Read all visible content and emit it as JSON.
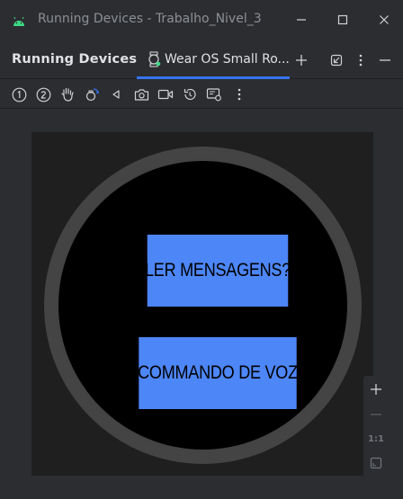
{
  "window": {
    "title": "Running Devices - Trabalho_Nivel_3",
    "controls": [
      "minimize-icon",
      "maximize-icon",
      "close-icon"
    ]
  },
  "panel": {
    "title": "Running Devices"
  },
  "device_tab": {
    "label": "Wear OS Small Ro...",
    "icon": "watch-device-icon",
    "active": true
  },
  "tab_tools": [
    "add-icon",
    "restore-window-icon",
    "more-vertical-icon",
    "minimize-panel-icon"
  ],
  "toolbar": {
    "icons": [
      "button-1-icon",
      "button-2-icon",
      "palm-gesture-icon",
      "tilt-gesture-icon",
      "back-icon",
      "screenshot-icon",
      "screen-record-icon",
      "rotate-icon",
      "snapshot-settings-icon",
      "more-vertical-icon"
    ]
  },
  "watch_screen": {
    "buttons": [
      {
        "label": "LER MENSAGENS?"
      },
      {
        "label": "COMMANDO DE VOZ"
      }
    ],
    "button_color": "#4d86f7",
    "screen_color": "#000000"
  },
  "zoom": {
    "zoom_in": "+",
    "zoom_out": "—",
    "actual_size": "1:1"
  },
  "colors": {
    "accent": "#3574f0",
    "background": "#2b2d30"
  }
}
